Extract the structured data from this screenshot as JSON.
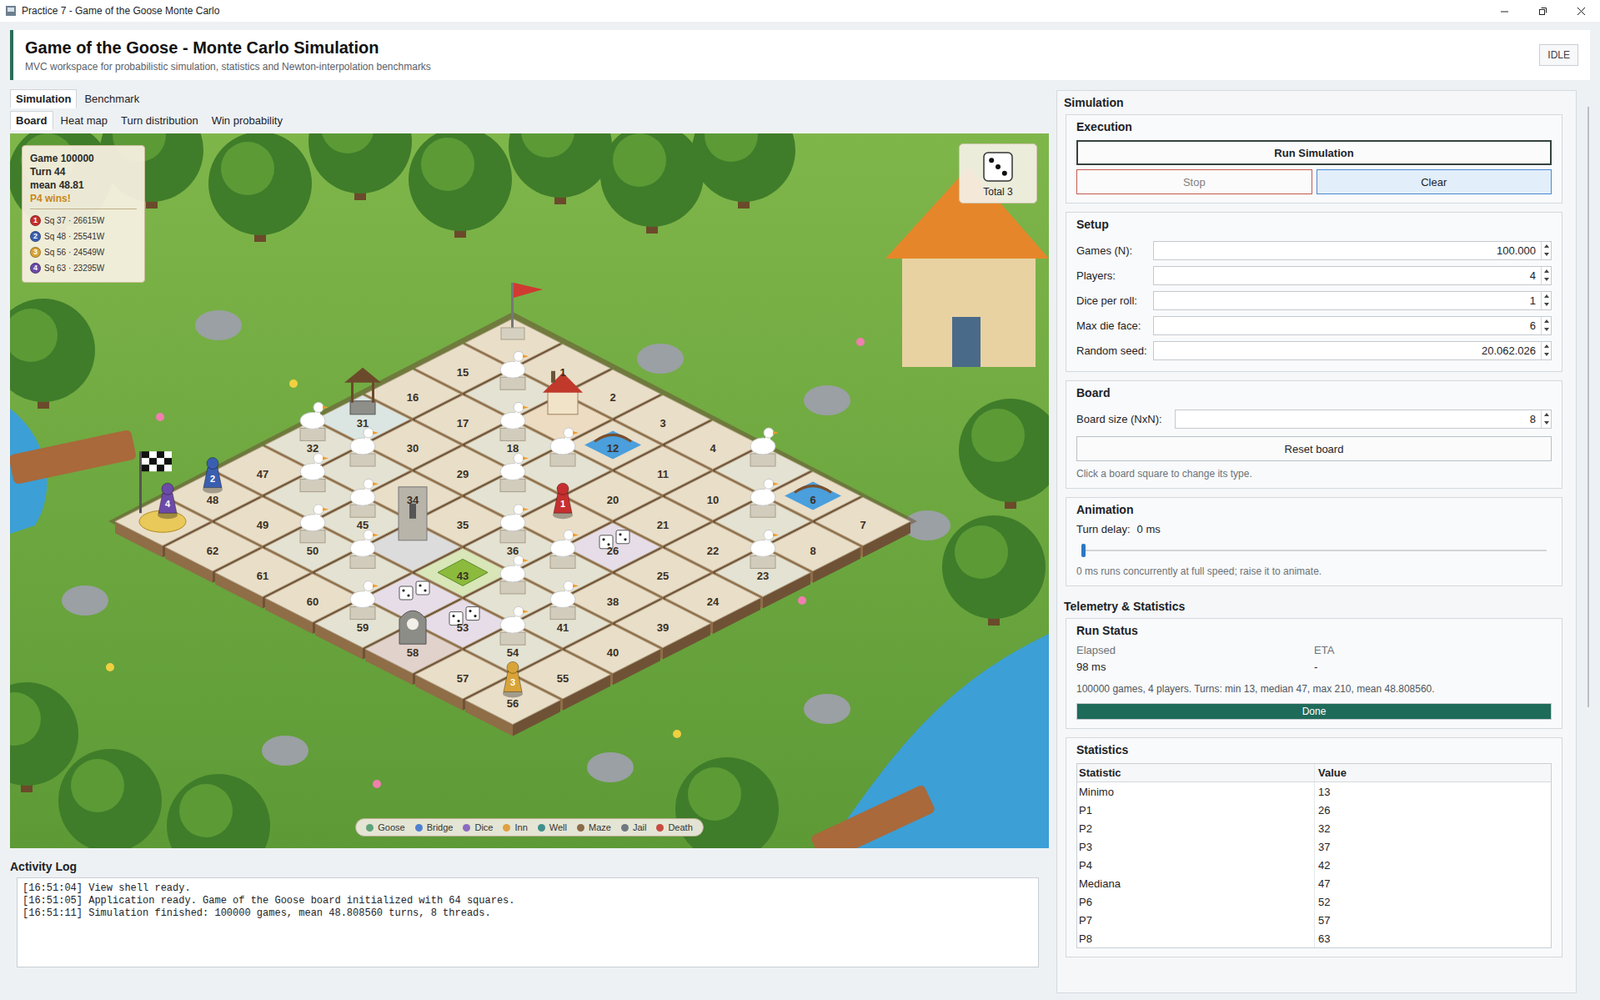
{
  "window": {
    "title": "Practice 7 - Game of the Goose Monte Carlo"
  },
  "header": {
    "title": "Game of the Goose - Monte Carlo Simulation",
    "subtitle": "MVC workspace for probabilistic simulation, statistics and Newton-interpolation benchmarks",
    "status": "IDLE"
  },
  "main_tabs": [
    {
      "label": "Simulation",
      "selected": true
    },
    {
      "label": "Benchmark",
      "selected": false
    }
  ],
  "view_tabs": [
    {
      "label": "Board",
      "selected": true
    },
    {
      "label": "Heat map",
      "selected": false
    },
    {
      "label": "Turn distribution",
      "selected": false
    },
    {
      "label": "Win probability",
      "selected": false
    }
  ],
  "board": {
    "squares": [
      {
        "label": "",
        "type": "start"
      },
      {
        "label": "1",
        "type": "normal"
      },
      {
        "label": "2",
        "type": "normal"
      },
      {
        "label": "3",
        "type": "normal"
      },
      {
        "label": "4",
        "type": "normal"
      },
      {
        "label": "",
        "type": "goose"
      },
      {
        "label": "6",
        "type": "bridge"
      },
      {
        "label": "7",
        "type": "normal"
      },
      {
        "label": "8",
        "type": "normal"
      },
      {
        "label": "",
        "type": "goose"
      },
      {
        "label": "10",
        "type": "normal"
      },
      {
        "label": "11",
        "type": "normal"
      },
      {
        "label": "12",
        "type": "bridge"
      },
      {
        "label": "",
        "type": "inn"
      },
      {
        "label": "",
        "type": "goose"
      },
      {
        "label": "15",
        "type": "normal"
      },
      {
        "label": "16",
        "type": "normal"
      },
      {
        "label": "17",
        "type": "normal"
      },
      {
        "label": "18",
        "type": "goose"
      },
      {
        "label": "",
        "type": "goose"
      },
      {
        "label": "20",
        "type": "normal"
      },
      {
        "label": "21",
        "type": "normal"
      },
      {
        "label": "22",
        "type": "normal"
      },
      {
        "label": "23",
        "type": "goose"
      },
      {
        "label": "24",
        "type": "normal"
      },
      {
        "label": "25",
        "type": "normal"
      },
      {
        "label": "26",
        "type": "dice"
      },
      {
        "label": "",
        "type": "normal"
      },
      {
        "label": "",
        "type": "goose"
      },
      {
        "label": "29",
        "type": "normal"
      },
      {
        "label": "30",
        "type": "normal"
      },
      {
        "label": "31",
        "type": "well"
      },
      {
        "label": "32",
        "type": "goose"
      },
      {
        "label": "",
        "type": "goose"
      },
      {
        "label": "34",
        "type": "normal"
      },
      {
        "label": "35",
        "type": "normal"
      },
      {
        "label": "36",
        "type": "goose"
      },
      {
        "label": "",
        "type": "goose"
      },
      {
        "label": "38",
        "type": "normal"
      },
      {
        "label": "39",
        "type": "normal"
      },
      {
        "label": "40",
        "type": "normal"
      },
      {
        "label": "41",
        "type": "goose"
      },
      {
        "label": "",
        "type": "goose"
      },
      {
        "label": "43",
        "type": "maze"
      },
      {
        "label": "",
        "type": "jail"
      },
      {
        "label": "45",
        "type": "goose"
      },
      {
        "label": "",
        "type": "goose"
      },
      {
        "label": "47",
        "type": "normal"
      },
      {
        "label": "48",
        "type": "normal"
      },
      {
        "label": "49",
        "type": "normal"
      },
      {
        "label": "50",
        "type": "goose"
      },
      {
        "label": "",
        "type": "goose"
      },
      {
        "label": "",
        "type": "dice"
      },
      {
        "label": "53",
        "type": "dice"
      },
      {
        "label": "54",
        "type": "goose"
      },
      {
        "label": "55",
        "type": "normal"
      },
      {
        "label": "56",
        "type": "normal"
      },
      {
        "label": "57",
        "type": "normal"
      },
      {
        "label": "58",
        "type": "death"
      },
      {
        "label": "59",
        "type": "goose"
      },
      {
        "label": "60",
        "type": "normal"
      },
      {
        "label": "61",
        "type": "normal"
      },
      {
        "label": "62",
        "type": "normal"
      },
      {
        "label": "",
        "type": "finish"
      }
    ],
    "pawns": [
      {
        "label": "1",
        "square": 27,
        "color": "#c62f2f"
      },
      {
        "label": "2",
        "square": 48,
        "color": "#3a5fb0"
      },
      {
        "label": "3",
        "square": 56,
        "color": "#d9a437"
      },
      {
        "label": "4",
        "square": 63,
        "color": "#6c4aa8"
      }
    ],
    "info": {
      "lines": [
        "Game 100000",
        "Turn 44",
        "mean 48.81"
      ],
      "result": "P4 wins!",
      "players": [
        {
          "badge": "1",
          "text": "Sq 37 · 26615W",
          "color": "#c62f2f"
        },
        {
          "badge": "2",
          "text": "Sq 48 · 25541W",
          "color": "#3a5fb0"
        },
        {
          "badge": "3",
          "text": "Sq 56 · 24549W",
          "color": "#d9a437"
        },
        {
          "badge": "4",
          "text": "Sq 63 · 23295W",
          "color": "#6c4aa8"
        }
      ]
    },
    "dice": {
      "values": [
        3
      ],
      "total": "Total 3"
    },
    "legend": [
      {
        "label": "Goose",
        "color": "#5fa37a"
      },
      {
        "label": "Bridge",
        "color": "#4f7fd0"
      },
      {
        "label": "Dice",
        "color": "#8a6cc0"
      },
      {
        "label": "Inn",
        "color": "#e0a040"
      },
      {
        "label": "Well",
        "color": "#3f8f8a"
      },
      {
        "label": "Maze",
        "color": "#8a6a48"
      },
      {
        "label": "Jail",
        "color": "#707880"
      },
      {
        "label": "Death",
        "color": "#c84a40"
      }
    ]
  },
  "log": {
    "title": "Activity Log",
    "lines": [
      "[16:51:04] View shell ready.",
      "[16:51:05] Application ready. Game of the Goose board initialized with 64 squares.",
      "[16:51:11] Simulation finished: 100000 games, mean 48.808560 turns, 8 threads."
    ]
  },
  "side": {
    "title": "Simulation",
    "execution": {
      "title": "Execution",
      "run": "Run Simulation",
      "stop": {
        "label": "Stop",
        "disabled": true
      },
      "clear": "Clear"
    },
    "setup": {
      "title": "Setup",
      "fields": [
        {
          "label": "Games (N):",
          "value": "100.000"
        },
        {
          "label": "Players:",
          "value": "4"
        },
        {
          "label": "Dice per roll:",
          "value": "1"
        },
        {
          "label": "Max die face:",
          "value": "6"
        },
        {
          "label": "Random seed:",
          "value": "20.062.026"
        }
      ]
    },
    "board": {
      "title": "Board",
      "field": {
        "label": "Board size (NxN):",
        "value": "8"
      },
      "reset": "Reset board",
      "hint": "Click a board square to change its type."
    },
    "animation": {
      "title": "Animation",
      "label": "Turn delay:",
      "reading": "0 ms",
      "level": 0,
      "hint": "0 ms runs concurrently at full speed; raise it to animate."
    }
  },
  "telemetry": {
    "title": "Telemetry & Statistics",
    "run_status": {
      "title": "Run Status",
      "elapsed_label": "Elapsed",
      "elapsed": "98 ms",
      "eta_label": "ETA",
      "eta": "-",
      "summary": "100000 games, 4 players. Turns: min 13, median 47, max 210, mean 48.808560.",
      "progress": {
        "level": 1,
        "text": "Done"
      }
    },
    "statistics": {
      "title": "Statistics",
      "columns": [
        "Statistic",
        "Value"
      ],
      "rows": [
        [
          "Minimo",
          "13"
        ],
        [
          "P1",
          "26"
        ],
        [
          "P2",
          "32"
        ],
        [
          "P3",
          "37"
        ],
        [
          "P4",
          "42"
        ],
        [
          "Mediana",
          "47"
        ],
        [
          "P6",
          "52"
        ],
        [
          "P7",
          "57"
        ],
        [
          "P8",
          "63"
        ]
      ]
    }
  }
}
